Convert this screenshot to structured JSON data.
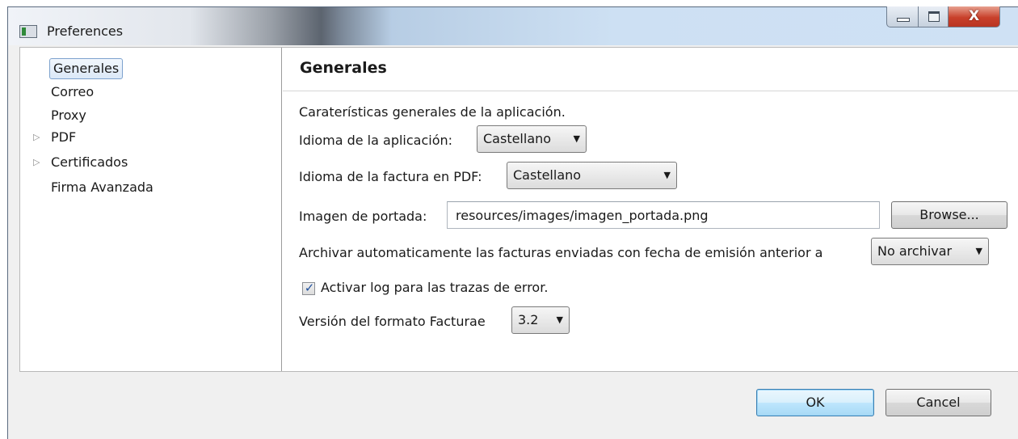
{
  "window": {
    "title": "Preferences",
    "controls": {
      "minimize": "minimize",
      "maximize": "maximize",
      "close_glyph": "X"
    }
  },
  "nav": {
    "items": [
      {
        "label": "Generales",
        "selected": true,
        "expandable": false
      },
      {
        "label": "Correo",
        "selected": false,
        "expandable": false
      },
      {
        "label": "Proxy",
        "selected": false,
        "expandable": false
      },
      {
        "label": "PDF",
        "selected": false,
        "expandable": true
      },
      {
        "label": "Certificados",
        "selected": false,
        "expandable": true
      },
      {
        "label": "Firma Avanzada",
        "selected": false,
        "expandable": false
      }
    ],
    "expander_glyph": "▷"
  },
  "panel": {
    "title": "Generales",
    "description": "Caraterísticas generales de la aplicación.",
    "app_language": {
      "label": "Idioma de la aplicación:",
      "value": "Castellano"
    },
    "pdf_language": {
      "label": "Idioma de la factura en PDF:",
      "value": "Castellano"
    },
    "cover_image": {
      "label": "Imagen de portada:",
      "value": "resources/images/imagen_portada.png",
      "browse": "Browse..."
    },
    "archive": {
      "label": "Archivar automaticamente las facturas enviadas con fecha de emisión anterior a",
      "value": "No archivar"
    },
    "log": {
      "label": "Activar log para las trazas de error.",
      "checked": true,
      "check_glyph": "✓"
    },
    "format_version": {
      "label": "Versión del formato Facturae",
      "value": "3.2"
    },
    "dropdown_glyph": "▼"
  },
  "footer": {
    "ok": "OK",
    "cancel": "Cancel"
  },
  "colors": {
    "selection_border": "#7da2ce",
    "close_button": "#c8402b",
    "default_button_border": "#3c7fb1"
  }
}
